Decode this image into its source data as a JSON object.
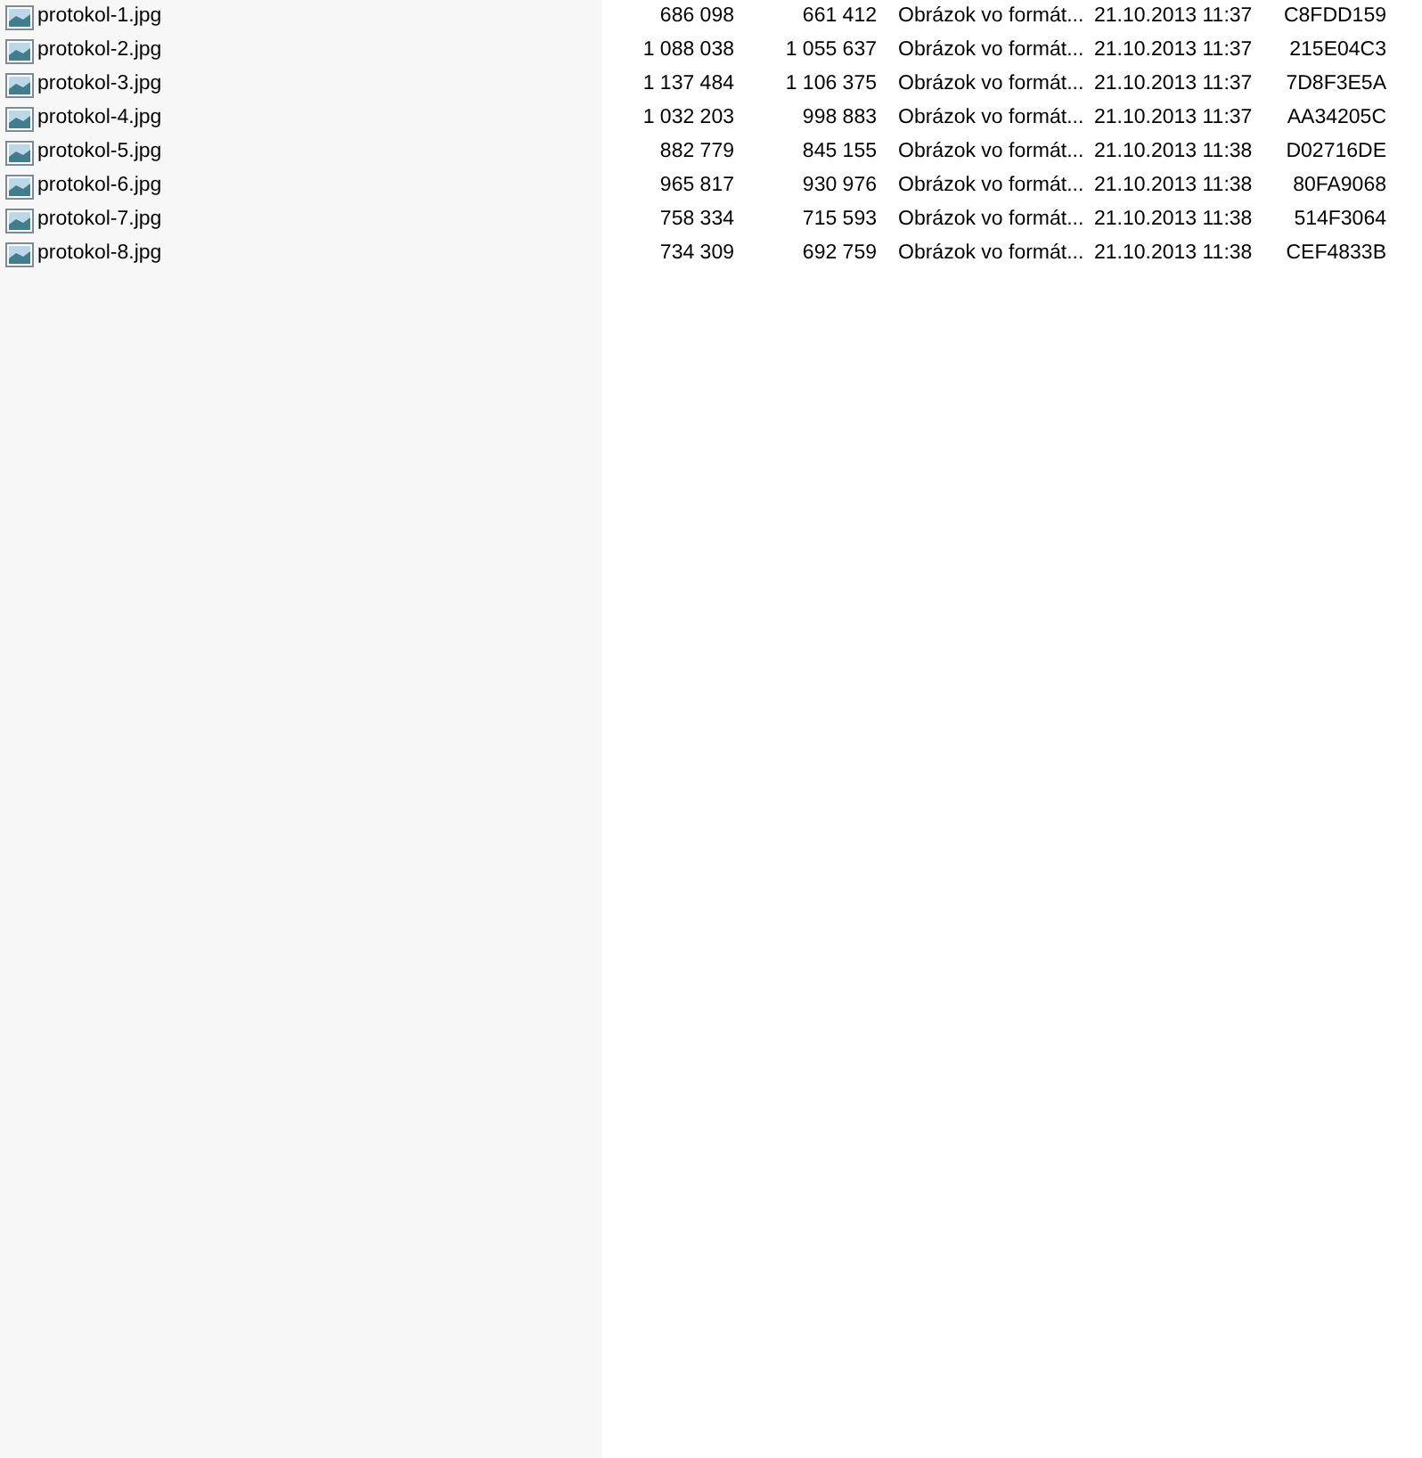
{
  "files": [
    {
      "name": "protokol-1.jpg",
      "cells": [
        "686 098",
        "661 412",
        "Obrázok vo formát...",
        "21.10.2013 11:37",
        "C8FDD159"
      ]
    },
    {
      "name": "protokol-2.jpg",
      "cells": [
        "1 088 038",
        "1 055 637",
        "Obrázok vo formát...",
        "21.10.2013 11:37",
        "215E04C3"
      ]
    },
    {
      "name": "protokol-3.jpg",
      "cells": [
        "1 137 484",
        "1 106 375",
        "Obrázok vo formát...",
        "21.10.2013 11:37",
        "7D8F3E5A"
      ]
    },
    {
      "name": "protokol-4.jpg",
      "cells": [
        "1 032 203",
        "998 883",
        "Obrázok vo formát...",
        "21.10.2013 11:37",
        "AA34205C"
      ]
    },
    {
      "name": "protokol-5.jpg",
      "cells": [
        "882 779",
        "845 155",
        "Obrázok vo formát...",
        "21.10.2013 11:38",
        "D02716DE"
      ]
    },
    {
      "name": "protokol-6.jpg",
      "cells": [
        "965 817",
        "930 976",
        "Obrázok vo formát...",
        "21.10.2013 11:38",
        "80FA9068"
      ]
    },
    {
      "name": "protokol-7.jpg",
      "cells": [
        "758 334",
        "715 593",
        "Obrázok vo formát...",
        "21.10.2013 11:38",
        "514F3064"
      ]
    },
    {
      "name": "protokol-8.jpg",
      "cells": [
        "734 309",
        "692 759",
        "Obrázok vo formát...",
        "21.10.2013 11:38",
        "CEF4833B"
      ]
    }
  ]
}
